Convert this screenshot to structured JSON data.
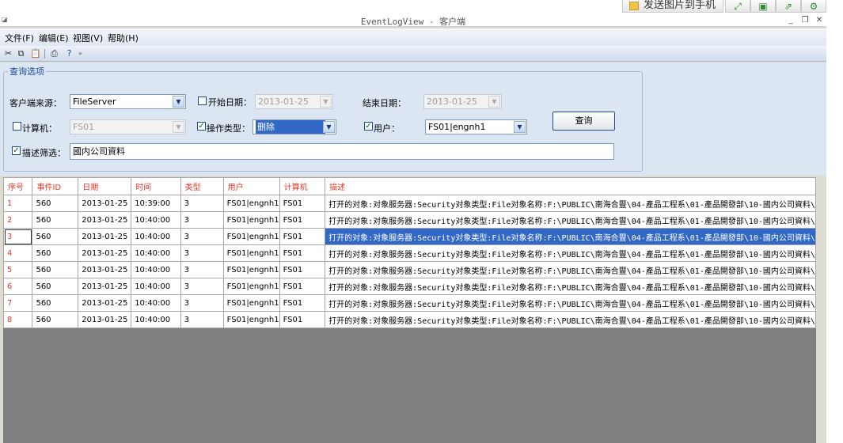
{
  "ext_toolbar": {
    "send_label": "发送图片到手机"
  },
  "window": {
    "title": "EventLogView - 客户端"
  },
  "menu": [
    "文件(F)",
    "编辑(E)",
    "视图(V)",
    "帮助(H)"
  ],
  "query": {
    "legend": "查询选项",
    "source_label": "客户端来源：",
    "source_value": "FileServer",
    "start_label": "开始日期：",
    "start_value": "2013-01-25",
    "end_label": "结束日期：",
    "end_value": "2013-01-25",
    "computer_label": "计算机：",
    "computer_value": "FS01",
    "optype_label": "操作类型：",
    "optype_value": "删除",
    "user_label": "用户：",
    "user_value": "FS01|engnh1",
    "desc_label": "描述筛选：",
    "desc_value": "國内公司資料",
    "query_button": "查询",
    "start_checked": false,
    "computer_checked": false,
    "optype_checked": true,
    "user_checked": true,
    "desc_checked": true
  },
  "grid": {
    "columns": [
      "序号",
      "事件ID",
      "日期",
      "时间",
      "类型",
      "用户",
      "计算机",
      "描述"
    ],
    "rows": [
      [
        "1",
        "560",
        "2013-01-25",
        "10:39:00",
        "3",
        "FS01|engnh1",
        "FS01",
        "打开的对象:对象服务器:Security对象类型:File对象名称:F:\\PUBLIC\\南海合豐\\04-產品工程系\\01-產品開發部\\10-國内公司資料\\"
      ],
      [
        "2",
        "560",
        "2013-01-25",
        "10:40:00",
        "3",
        "FS01|engnh1",
        "FS01",
        "打开的对象:对象服务器:Security对象类型:File对象名称:F:\\PUBLIC\\南海合豐\\04-產品工程系\\01-產品開發部\\10-國内公司資料\\"
      ],
      [
        "3",
        "560",
        "2013-01-25",
        "10:40:00",
        "3",
        "FS01|engnh1",
        "FS01",
        "打开的对象:对象服务器:Security对象类型:File对象名称:F:\\PUBLIC\\南海合豐\\04-產品工程系\\01-產品開發部\\10-國内公司資料\\"
      ],
      [
        "4",
        "560",
        "2013-01-25",
        "10:40:00",
        "3",
        "FS01|engnh1",
        "FS01",
        "打开的对象:对象服务器:Security对象类型:File对象名称:F:\\PUBLIC\\南海合豐\\04-產品工程系\\01-產品開發部\\10-國内公司資料\\"
      ],
      [
        "5",
        "560",
        "2013-01-25",
        "10:40:00",
        "3",
        "FS01|engnh1",
        "FS01",
        "打开的对象:对象服务器:Security对象类型:File对象名称:F:\\PUBLIC\\南海合豐\\04-產品工程系\\01-產品開發部\\10-國内公司資料\\"
      ],
      [
        "6",
        "560",
        "2013-01-25",
        "10:40:00",
        "3",
        "FS01|engnh1",
        "FS01",
        "打开的对象:对象服务器:Security对象类型:File对象名称:F:\\PUBLIC\\南海合豐\\04-產品工程系\\01-產品開發部\\10-國内公司資料\\"
      ],
      [
        "7",
        "560",
        "2013-01-25",
        "10:40:00",
        "3",
        "FS01|engnh1",
        "FS01",
        "打开的对象:对象服务器:Security对象类型:File对象名称:F:\\PUBLIC\\南海合豐\\04-產品工程系\\01-產品開發部\\10-國内公司資料\\"
      ],
      [
        "8",
        "560",
        "2013-01-25",
        "10:40:00",
        "3",
        "FS01|engnh1",
        "FS01",
        "打开的对象:对象服务器:Security对象类型:File对象名称:F:\\PUBLIC\\南海合豐\\04-產品工程系\\01-產品開發部\\10-國内公司資料\\"
      ]
    ],
    "selected_row": 2
  },
  "colors": {
    "selection": "#3168c5",
    "header_text": "#e23b2b",
    "grid_empty": "#808080"
  }
}
